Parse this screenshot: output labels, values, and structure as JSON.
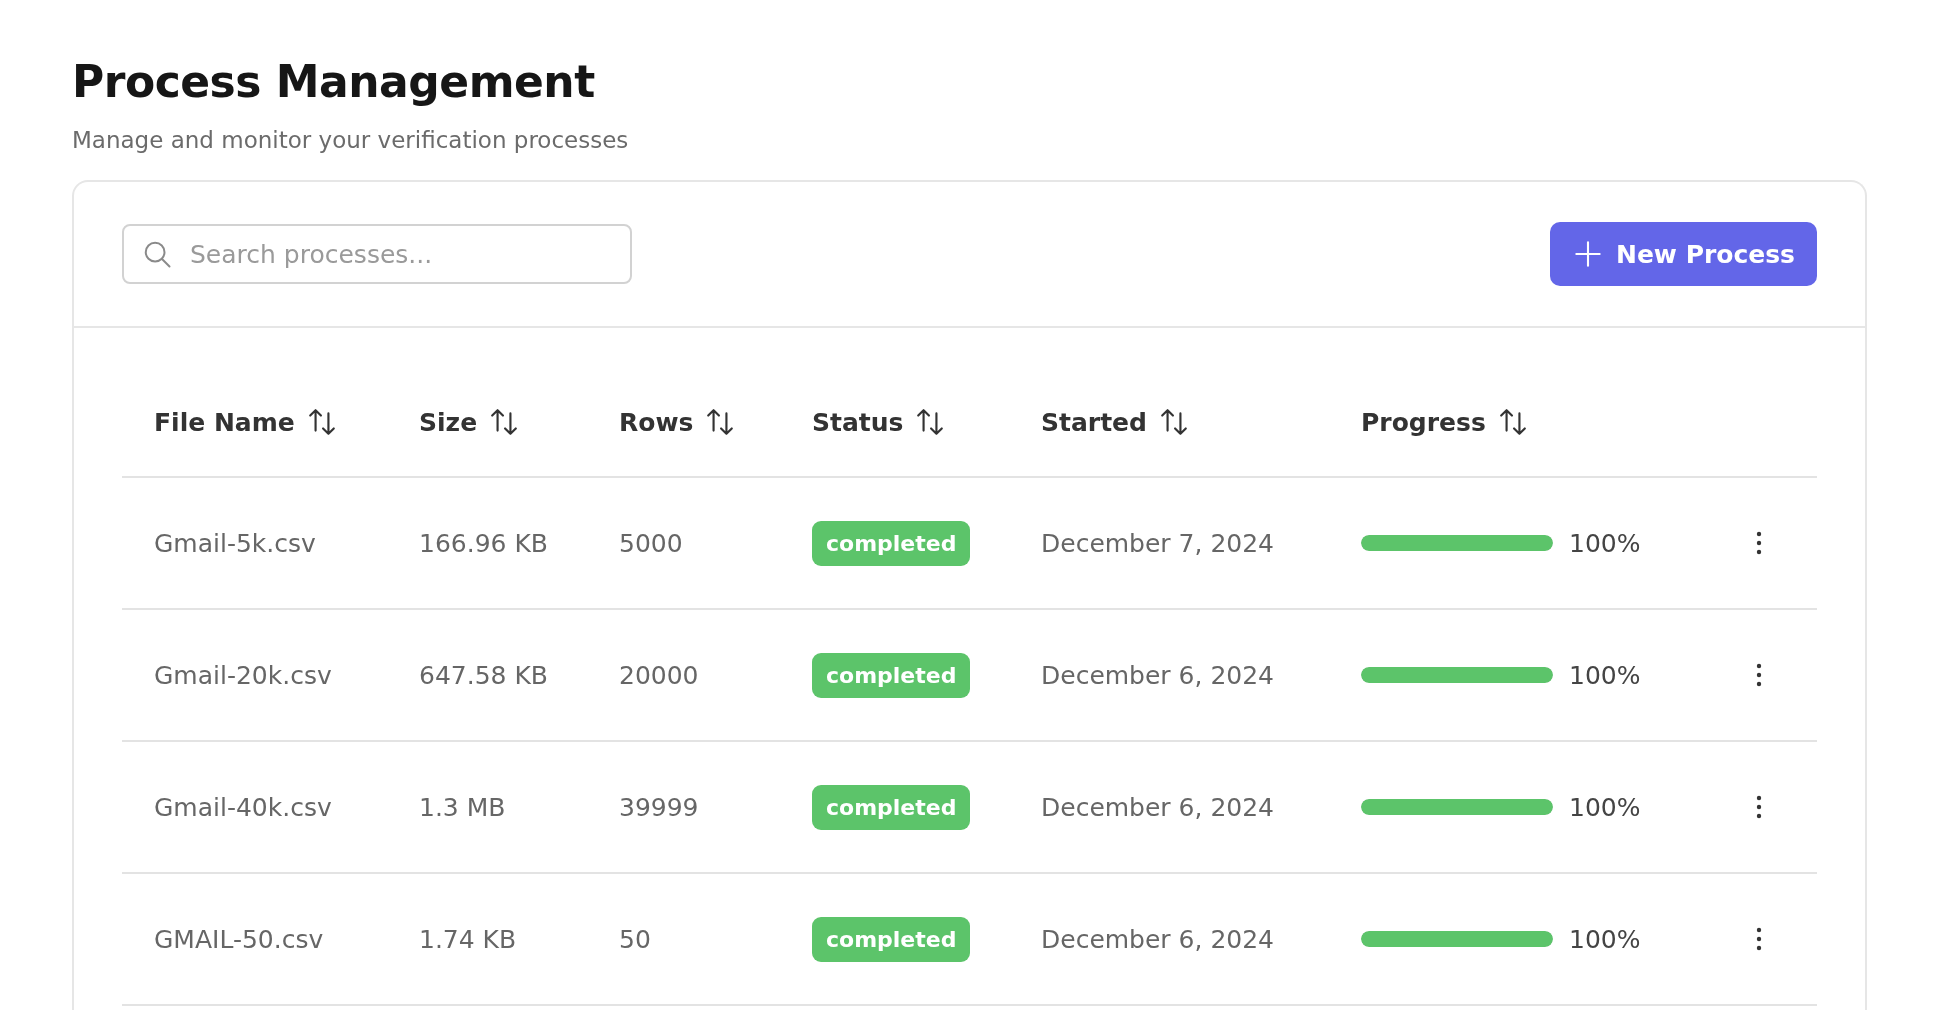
{
  "page": {
    "title": "Process Management",
    "subtitle": "Manage and monitor your verification processes"
  },
  "toolbar": {
    "search": {
      "placeholder": "Search processes..."
    },
    "new_button": "New Process"
  },
  "table": {
    "columns": [
      {
        "label": "File Name",
        "sortable": true
      },
      {
        "label": "Size",
        "sortable": true
      },
      {
        "label": "Rows",
        "sortable": true
      },
      {
        "label": "Status",
        "sortable": true
      },
      {
        "label": "Started",
        "sortable": true
      },
      {
        "label": "Progress",
        "sortable": true
      }
    ],
    "rows": [
      {
        "file_name": "Gmail-5k.csv",
        "size": "166.96 KB",
        "rows": "5000",
        "status": "completed",
        "started": "December 7, 2024",
        "progress": {
          "level": 1,
          "reading": "100%"
        }
      },
      {
        "file_name": "Gmail-20k.csv",
        "size": "647.58 KB",
        "rows": "20000",
        "status": "completed",
        "started": "December 6, 2024",
        "progress": {
          "level": 1,
          "reading": "100%"
        }
      },
      {
        "file_name": "Gmail-40k.csv",
        "size": "1.3 MB",
        "rows": "39999",
        "status": "completed",
        "started": "December 6, 2024",
        "progress": {
          "level": 1,
          "reading": "100%"
        }
      },
      {
        "file_name": "GMAIL-50.csv",
        "size": "1.74 KB",
        "rows": "50",
        "status": "completed",
        "started": "December 6, 2024",
        "progress": {
          "level": 1,
          "reading": "100%"
        }
      }
    ]
  }
}
